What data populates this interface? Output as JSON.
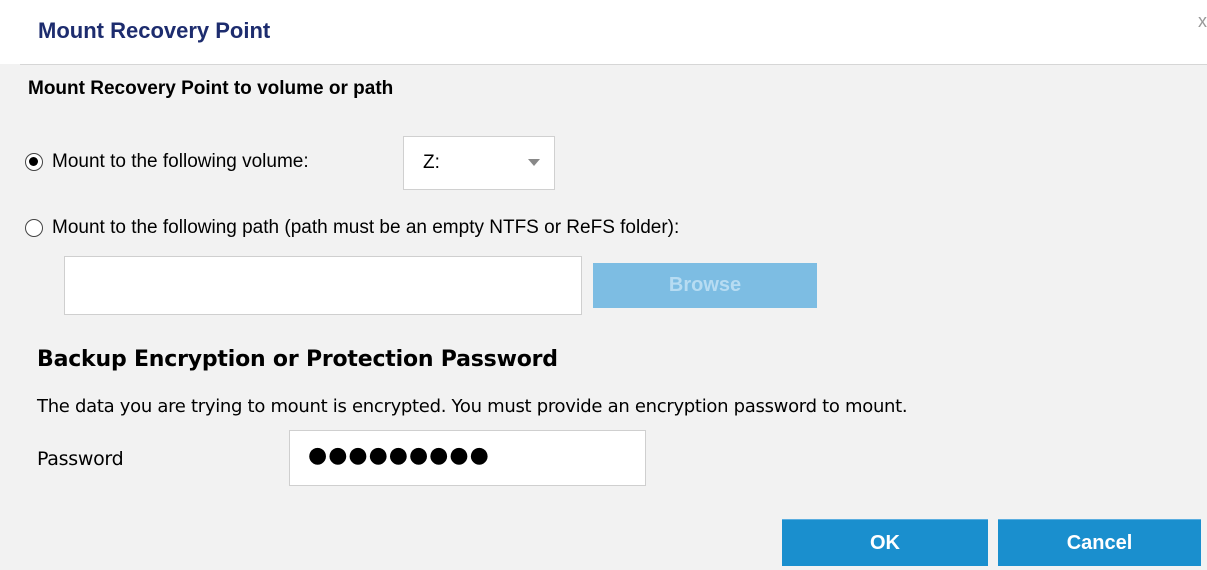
{
  "dialog": {
    "title": "Mount Recovery Point",
    "close_glyph": "x",
    "section_heading": "Mount Recovery Point to volume or path",
    "volume_option": {
      "label": "Mount to the following volume:",
      "selected": true,
      "value": "Z:"
    },
    "path_option": {
      "label": "Mount to the following path (path must be an empty NTFS or ReFS folder):",
      "selected": false,
      "value": "",
      "browse_label": "Browse",
      "browse_enabled": false
    },
    "encryption": {
      "heading": "Backup Encryption or Protection Password",
      "description": "The data you are trying to mount is encrypted. You must provide an encryption password to mount.",
      "password_label": "Password",
      "password_mask": "●●●●●●●●●"
    },
    "buttons": {
      "ok_label": "OK",
      "cancel_label": "Cancel"
    }
  },
  "colors": {
    "title": "#1d2c6e",
    "primary_button": "#1a8fce",
    "disabled_button": "#7dbde3",
    "panel_background": "#f2f2f2"
  },
  "icons": {
    "volume_radio": "radio-checked-icon",
    "path_radio": "radio-unchecked-icon",
    "select_arrow": "chevron-down-icon",
    "close": "close-icon"
  }
}
